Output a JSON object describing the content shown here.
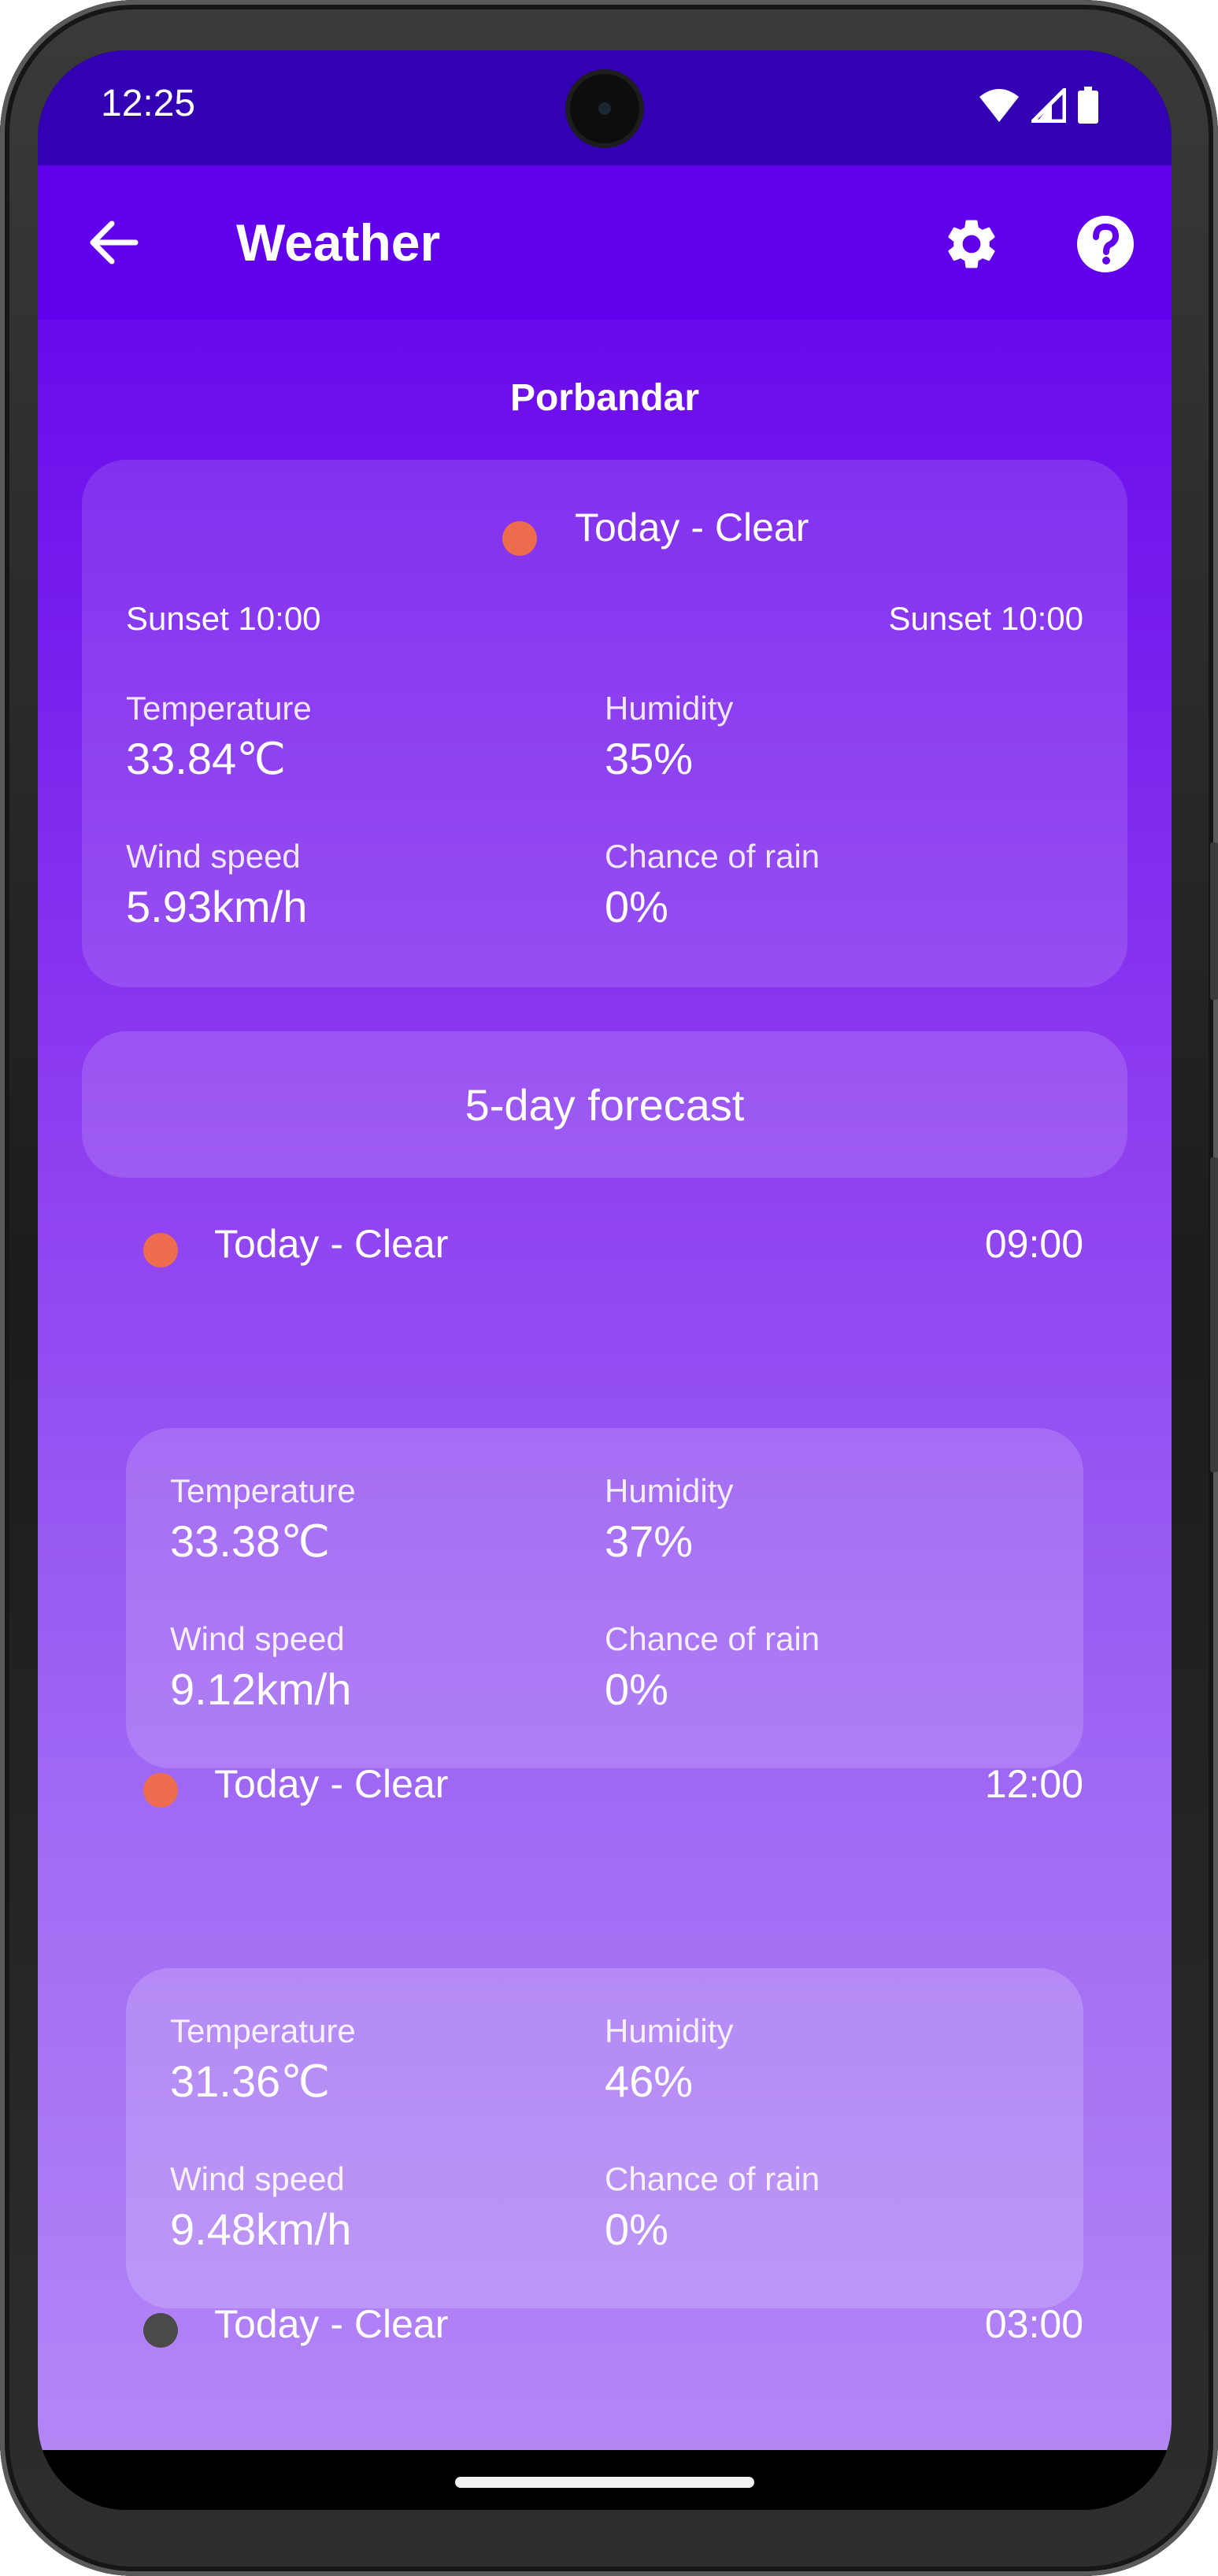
{
  "status_bar": {
    "time": "12:25",
    "icons": [
      "wifi-icon",
      "signal-icon",
      "battery-icon"
    ]
  },
  "app_bar": {
    "title": "Weather",
    "icons": [
      "back-arrow-icon",
      "gear-icon",
      "help-icon"
    ]
  },
  "location": "Porbandar",
  "current": {
    "condition": "Today - Clear",
    "sunrise_label": "Sunset 10:00",
    "sunset_label": "Sunset 10:00",
    "temperature_label": "Temperature",
    "temperature": "33.84℃",
    "humidity_label": "Humidity",
    "humidity": "35%",
    "wind_label": "Wind speed",
    "wind": "5.93km/h",
    "rain_label": "Chance of rain",
    "rain": "0%"
  },
  "forecast_button": "5-day forecast",
  "forecast": [
    {
      "condition": "Today - Clear",
      "time": "09:00",
      "icon": "sun-icon",
      "temperature_label": "Temperature",
      "temperature": "33.38℃",
      "humidity_label": "Humidity",
      "humidity": "37%",
      "wind_label": "Wind speed",
      "wind": "9.12km/h",
      "rain_label": "Chance of rain",
      "rain": "0%"
    },
    {
      "condition": "Today - Clear",
      "time": "12:00",
      "icon": "sun-icon",
      "temperature_label": "Temperature",
      "temperature": "31.36℃",
      "humidity_label": "Humidity",
      "humidity": "46%",
      "wind_label": "Wind speed",
      "wind": "9.48km/h",
      "rain_label": "Chance of rain",
      "rain": "0%"
    },
    {
      "condition": "Today - Clear",
      "time": "03:00",
      "icon": "moon-icon"
    }
  ],
  "colors": {
    "status_bar": "#3400b3",
    "app_bar": "#6100ea",
    "sun": "#ee6c4e",
    "moon": "#4a4a4a"
  }
}
